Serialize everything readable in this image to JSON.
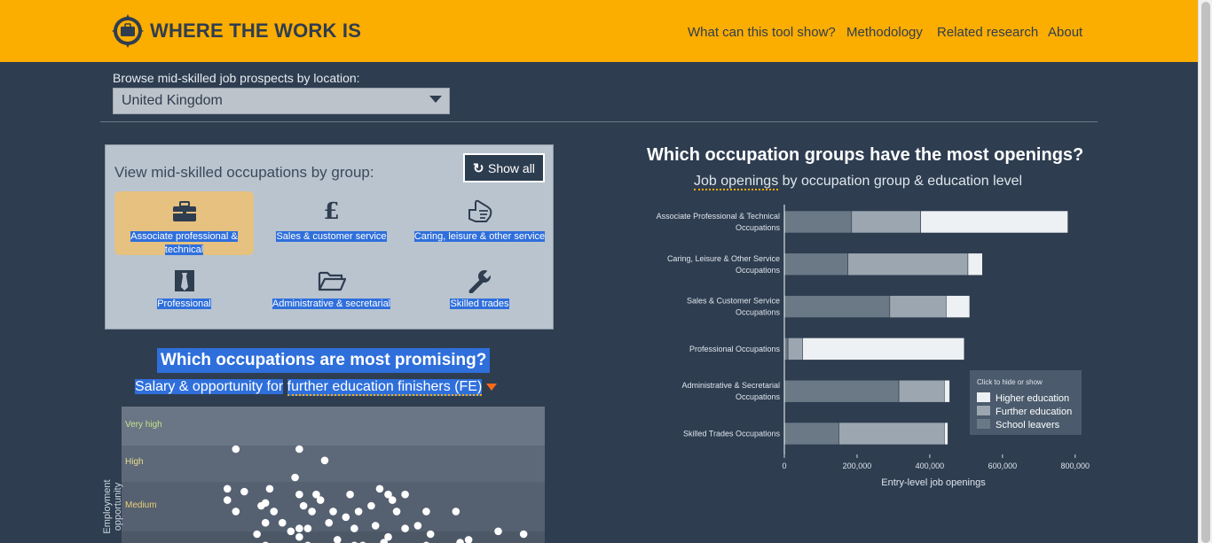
{
  "header": {
    "brand": "WHERE THE WORK IS",
    "logo_icon": "compass-briefcase-icon",
    "nav": [
      "What can this tool show?",
      "Methodology",
      "Related research",
      "About"
    ],
    "background": "#fbad00"
  },
  "location": {
    "label": "Browse mid-skilled job prospects by location:",
    "selected": "United Kingdom"
  },
  "groups": {
    "title": "View mid-skilled occupations by group:",
    "show_all_label": "Show all",
    "show_all_icon": "refresh-icon",
    "items": [
      {
        "label": "Associate professional & technical",
        "icon": "briefcase-icon",
        "active": true
      },
      {
        "label": "Sales & customer service",
        "icon": "pound-icon",
        "active": false
      },
      {
        "label": "Caring, leisure & other service",
        "icon": "hand-icon",
        "active": false
      },
      {
        "label": "Professional",
        "icon": "tie-icon",
        "active": false
      },
      {
        "label": "Administrative & secretarial",
        "icon": "folder-icon",
        "active": false
      },
      {
        "label": "Skilled trades",
        "icon": "wrench-icon",
        "active": false
      }
    ]
  },
  "promising": {
    "title": "Which occupations are most promising?",
    "subtitle_prefix": "Salary & opportunity for",
    "subtitle_link": "further education finishers (FE)",
    "y_axis_title": "Employment opportunity",
    "bands": [
      "Very high",
      "High",
      "Medium"
    ]
  },
  "openings": {
    "title": "Which occupation groups have the most openings?",
    "subtitle_link": "Job openings",
    "subtitle_rest": " by occupation group & education level",
    "legend_hint": "Click to hide or show"
  },
  "chart_data": [
    {
      "type": "bar",
      "orientation": "horizontal",
      "stacked": true,
      "categories": [
        [
          "Associate Professional & Technical",
          "Occupations"
        ],
        [
          "Caring, Leisure & Other Service",
          "Occupations"
        ],
        [
          "Sales & Customer Service",
          "Occupations"
        ],
        [
          "Professional Occupations"
        ],
        [
          "Administrative & Secretarial",
          "Occupations"
        ],
        [
          "Skilled Trades Occupations"
        ]
      ],
      "series": [
        {
          "name": "School leavers",
          "color": "#6b7886",
          "values": [
            185000,
            175000,
            290000,
            10000,
            315000,
            150000
          ]
        },
        {
          "name": "Further education",
          "color": "#9ca6b0",
          "values": [
            190000,
            330000,
            155000,
            40000,
            125000,
            290000
          ]
        },
        {
          "name": "Higher education",
          "color": "#edf1f3",
          "values": [
            405000,
            40000,
            65000,
            445000,
            15000,
            10000
          ]
        }
      ],
      "xlabel": "Entry-level job openings",
      "xlim": [
        0,
        820000
      ],
      "xticks": [
        0,
        200000,
        400000,
        600000,
        800000
      ],
      "xtick_labels": [
        "0",
        "200,000",
        "400,000",
        "600,000",
        "800,000"
      ],
      "legend": "right",
      "grid": false
    },
    {
      "type": "scatter",
      "ylabel": "Employment opportunity",
      "y_bands": [
        "Very high",
        "High",
        "Medium"
      ],
      "x_range": [
        0,
        100
      ],
      "y_range": [
        0,
        100
      ],
      "points": [
        [
          27,
          15
        ],
        [
          42,
          15
        ],
        [
          48,
          19
        ],
        [
          25,
          29
        ],
        [
          25,
          33
        ],
        [
          29,
          30
        ],
        [
          35,
          29
        ],
        [
          41,
          25
        ],
        [
          42,
          31
        ],
        [
          46,
          31
        ],
        [
          47,
          33
        ],
        [
          54,
          31
        ],
        [
          61,
          29
        ],
        [
          63,
          31
        ],
        [
          64,
          33
        ],
        [
          67,
          31
        ],
        [
          27,
          37
        ],
        [
          33,
          35
        ],
        [
          34,
          34
        ],
        [
          36,
          37
        ],
        [
          43,
          35
        ],
        [
          45,
          37
        ],
        [
          50,
          37
        ],
        [
          53,
          39
        ],
        [
          56,
          37
        ],
        [
          59,
          35
        ],
        [
          65,
          37
        ],
        [
          72,
          37
        ],
        [
          79,
          37
        ],
        [
          34,
          41
        ],
        [
          38,
          41
        ],
        [
          42,
          43
        ],
        [
          44,
          43
        ],
        [
          49,
          41
        ],
        [
          55,
          43
        ],
        [
          60,
          42
        ],
        [
          67,
          43
        ],
        [
          70,
          42
        ],
        [
          32,
          45
        ],
        [
          40,
          44
        ],
        [
          42,
          46
        ],
        [
          51,
          47
        ],
        [
          63,
          46
        ],
        [
          73,
          45
        ],
        [
          82,
          47
        ],
        [
          89,
          44
        ],
        [
          95,
          45
        ],
        [
          34,
          49
        ],
        [
          44,
          49
        ],
        [
          55,
          49
        ],
        [
          57,
          49
        ],
        [
          62,
          48
        ],
        [
          72,
          49
        ],
        [
          80,
          48
        ]
      ]
    }
  ]
}
